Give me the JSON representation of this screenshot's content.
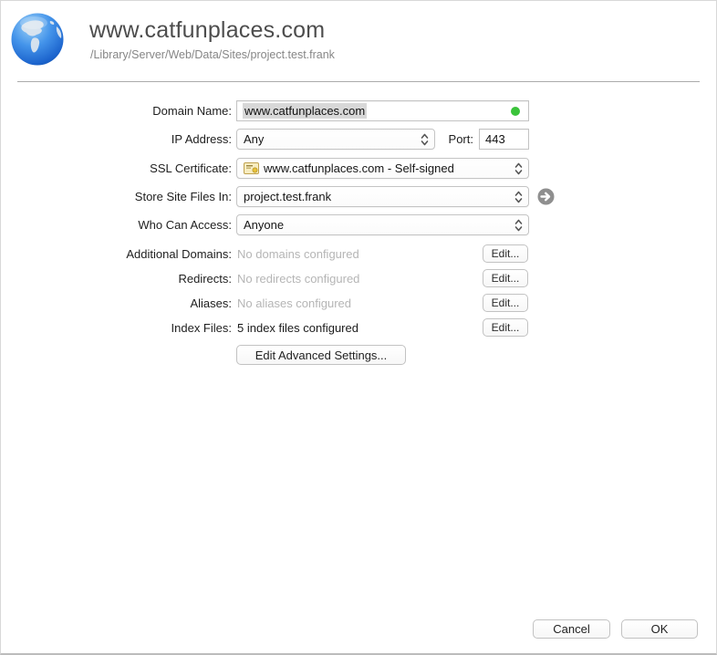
{
  "window": {
    "title": "www.catfunplaces.com",
    "subtitle": "/Library/Server/Web/Data/Sites/project.test.frank"
  },
  "form": {
    "domain_name": {
      "label": "Domain Name:",
      "value": "www.catfunplaces.com"
    },
    "ip_address": {
      "label": "IP Address:",
      "value": "Any"
    },
    "port": {
      "label": "Port:",
      "value": "443"
    },
    "ssl_certificate": {
      "label": "SSL Certificate:",
      "value": "www.catfunplaces.com - Self-signed"
    },
    "store_site_files_in": {
      "label": "Store Site Files In:",
      "value": "project.test.frank"
    },
    "who_can_access": {
      "label": "Who Can Access:",
      "value": "Anyone"
    },
    "summary_rows": [
      {
        "label": "Additional Domains:",
        "value": "No domains configured",
        "button": "Edit..."
      },
      {
        "label": "Redirects:",
        "value": "No redirects configured",
        "button": "Edit..."
      },
      {
        "label": "Aliases:",
        "value": "No aliases configured",
        "button": "Edit..."
      },
      {
        "label": "Index Files:",
        "value": "5 index files configured",
        "button": "Edit..."
      }
    ],
    "advanced_button": "Edit Advanced Settings..."
  },
  "footer": {
    "cancel": "Cancel",
    "ok": "OK"
  },
  "icons": {
    "globe-icon": "blue world globe",
    "certificate-icon": "yellow certificate document",
    "chevron-updown-icon": "popup up/down chevrons",
    "arrow-circle-icon": "gray circle with white right arrow"
  },
  "colors": {
    "status_green": "#3ac33a",
    "selection_gray": "#d8d8d8",
    "muted_text": "#b5b5b5"
  }
}
